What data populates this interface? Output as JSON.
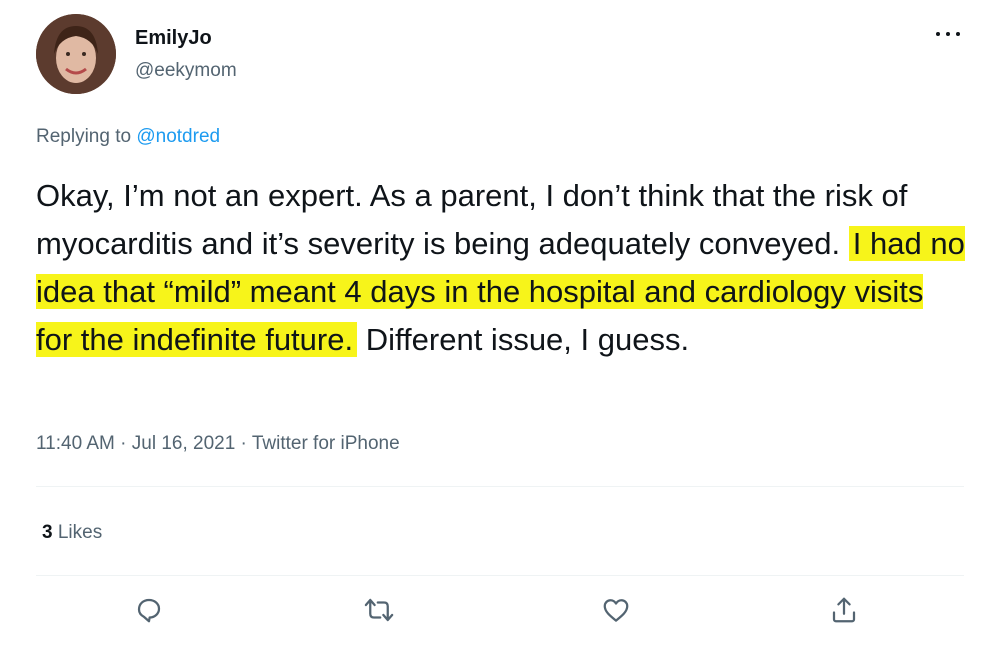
{
  "author": {
    "name": "EmilyJo",
    "handle": "@eekymom"
  },
  "reply": {
    "prefix": "Replying to",
    "mention": "@notdred"
  },
  "tweet": {
    "text_before": "Okay, I’m not an expert. As a parent, I don’t think that the risk of myocarditis and it’s severity is being adequately conveyed.",
    "text_highlighted": "I had no idea that “mild” meant 4 days in the hospital and cardiology visits for the indefinite future.",
    "text_after": "Different issue, I guess.",
    "highlight_color": "#f7f41a"
  },
  "meta": {
    "timestamp": "11:40 AM · Jul 16, 2021 · Twitter for iPhone"
  },
  "stats": {
    "likes_count": "3",
    "likes_label": "Likes"
  },
  "actions": [
    {
      "icon": "reply-icon"
    },
    {
      "icon": "retweet-icon"
    },
    {
      "icon": "like-icon"
    },
    {
      "icon": "share-icon"
    }
  ],
  "colors": {
    "text": "#0f1419",
    "secondary": "#536471",
    "link": "#1d9bf0",
    "divider": "#eff3f4"
  }
}
